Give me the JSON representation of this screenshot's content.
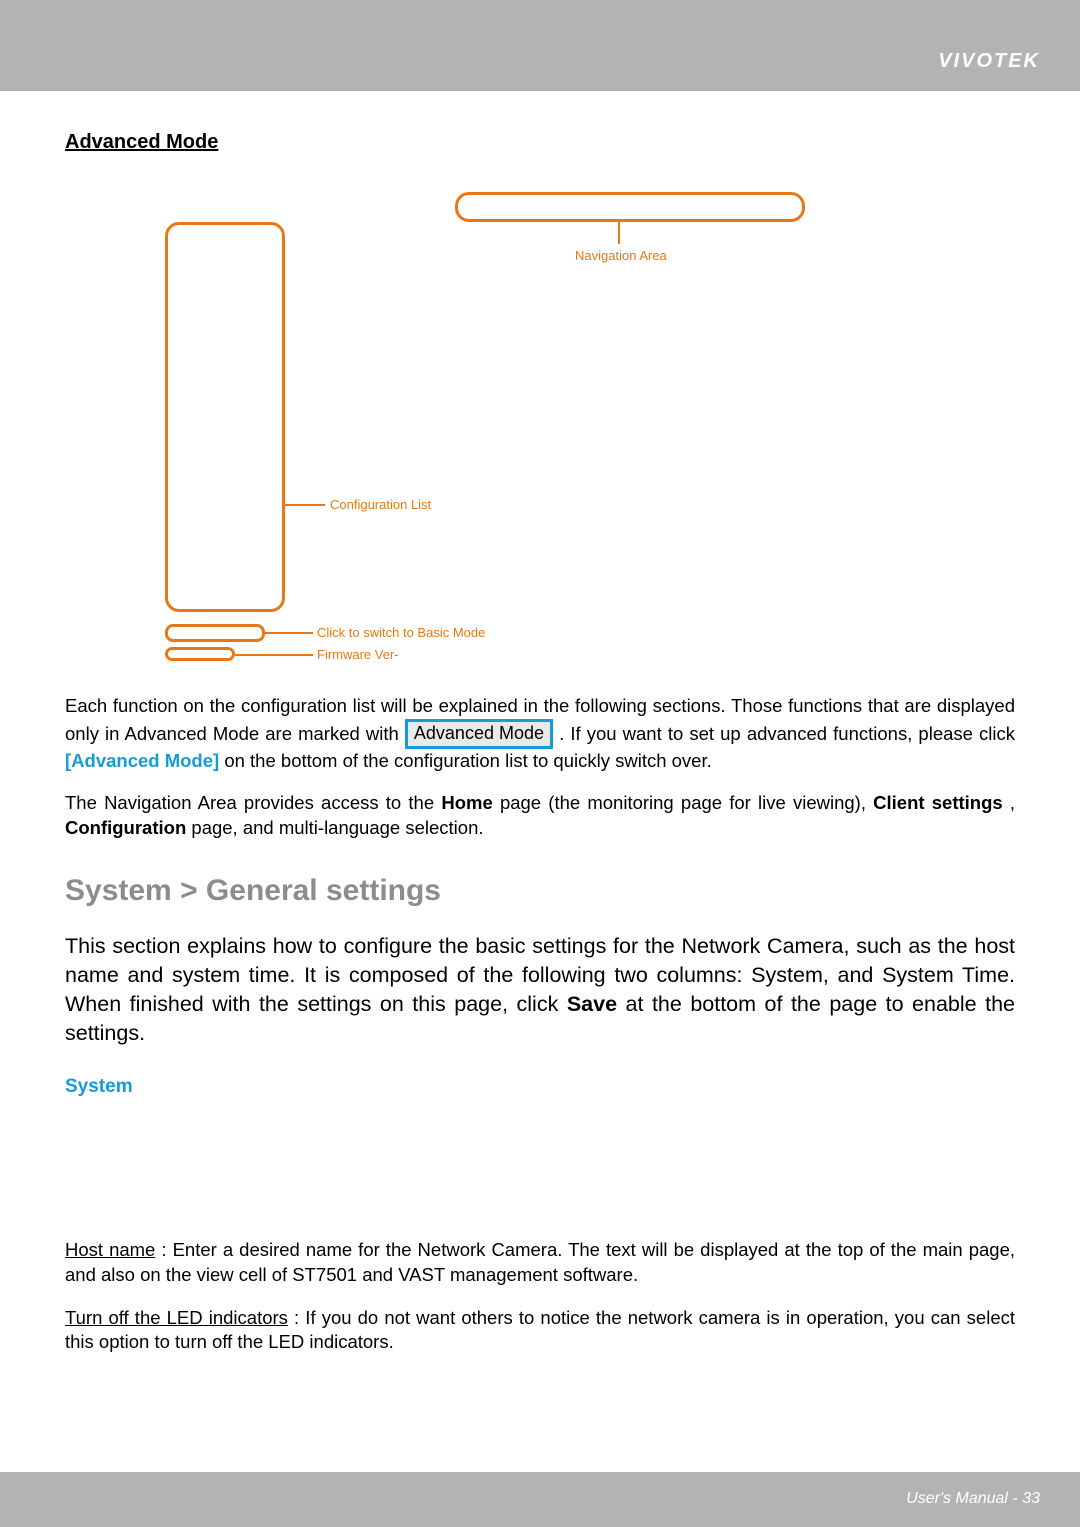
{
  "header": {
    "brand": "VIVOTEK"
  },
  "section_title": "Advanced Mode",
  "diagram": {
    "nav_label": "Navigation Area",
    "config_label": "Configuration List",
    "basic_label": "Click to switch to Basic Mode",
    "fw_label": "Firmware Ver-"
  },
  "para1_a": "Each function on the configuration list will be explained in the following sections. Those functions that are displayed only in Advanced Mode are marked with ",
  "para1_badge": "Advanced Mode",
  "para1_b": ". If you want to set up advanced functions, please click ",
  "para1_link": "[Advanced Mode]",
  "para1_c": " on the bottom of the configuration list to quickly switch over.",
  "para2_a": "The Navigation Area provides access to the ",
  "para2_home": "Home",
  "para2_b": " page (the monitoring page for live viewing), ",
  "para2_client": "Client settings",
  "para2_c": ", ",
  "para2_config": "Configuration",
  "para2_d": " page, and multi-language selection.",
  "big_heading": "System > General settings",
  "intro_a": "This section explains how to configure the basic settings for the Network Camera, such as the host name and system time. It is composed of the following two columns: System, and System Time. When finished with the settings on this page, click ",
  "intro_save": "Save",
  "intro_b": " at the bottom of the page to enable the settings.",
  "sub_blue": "System",
  "host_label": "Host name",
  "host_text": ": Enter a desired name for the Network Camera. The text will be displayed at the top of the main page, and also on the view cell of ST7501 and VAST management software.",
  "led_label": "Turn off the LED indicators",
  "led_text": ": If you do not want others to notice the network camera is in operation, you can select this option to turn off the LED indicators.",
  "footer": {
    "page_label": "User's Manual - 33"
  }
}
